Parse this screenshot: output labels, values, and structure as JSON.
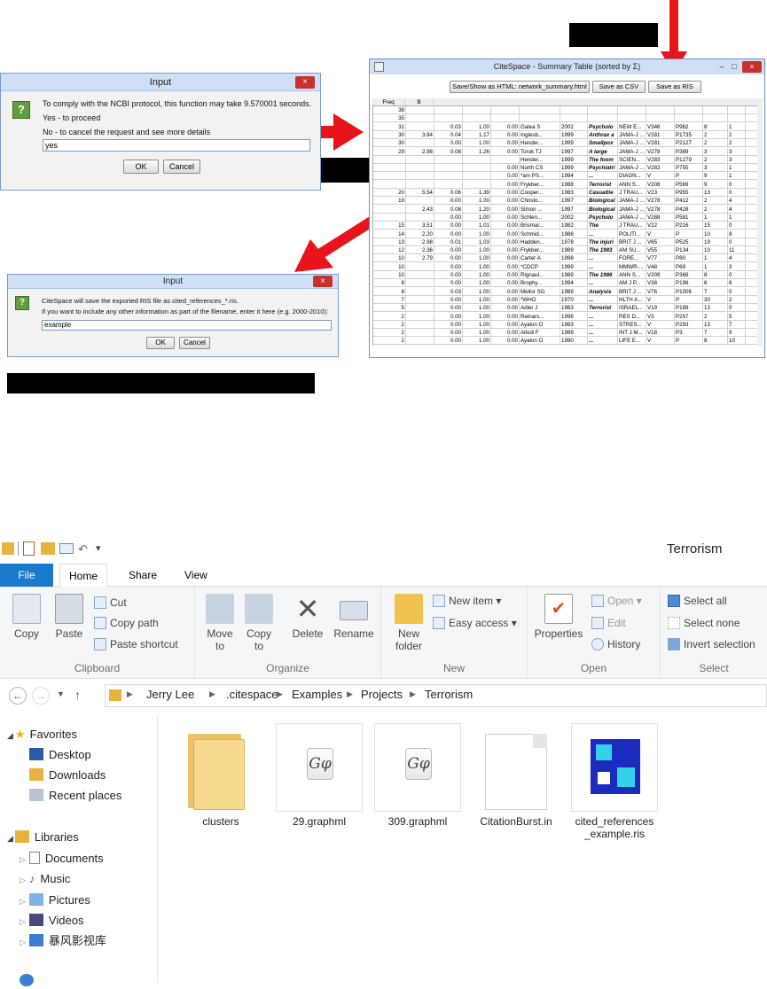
{
  "ncbi_dialog": {
    "title": "Input",
    "close": "×",
    "icon": "?",
    "line1": "To comply with the NCBI protocol, this function may take 9.570001 seconds.",
    "line2": "Yes - to proceed",
    "line3": "No - to cancel the request and see more details",
    "input_value": "yes",
    "ok": "OK",
    "cancel": "Cancel"
  },
  "ris_dialog": {
    "title": "Input",
    "close": "×",
    "icon": "?",
    "line1": "CiteSpace will save the exported RIS file as cited_references_*.ris.",
    "line2": "If you want to include any other information as part of the filename, enter it here (e.g. 2000-2010):",
    "input_value": "example",
    "ok": "OK",
    "cancel": "Cancel"
  },
  "summary_window": {
    "title": "CiteSpace - Summary Table (sorted by Σ)",
    "controls": {
      "min": "–",
      "max": "□",
      "close": "×"
    },
    "buttons": {
      "save_html": "Save/Show as HTML: network_summary.html",
      "save_csv": "Save as CSV",
      "save_ris": "Save as RIS"
    },
    "col_freq": "Freq",
    "col_b": "B",
    "rows": [
      [
        "38",
        "",
        "",
        "",
        "",
        "",
        "",
        "",
        "",
        "",
        "",
        "",
        ""
      ],
      [
        "35",
        "",
        "",
        "",
        "",
        "",
        "",
        "",
        "",
        "",
        "",
        "",
        ""
      ],
      [
        "31",
        "",
        "0.03",
        "1.00",
        "0.00",
        "Galea S",
        "2002",
        "Psycholo",
        "NEW E...",
        "V346",
        "P982",
        "8",
        "1"
      ],
      [
        "30",
        "3.84",
        "0.04",
        "1.17",
        "0.00",
        "Inglesb...",
        "1999",
        "Anthrax a",
        "JAMA-J ...",
        "V281",
        "P1735",
        "2",
        "2"
      ],
      [
        "30",
        "",
        "0.00",
        "1.00",
        "0.00",
        "Hender...",
        "1999",
        "Smallpox",
        "JAMA-J ...",
        "V281",
        "P2127",
        "2",
        "2"
      ],
      [
        "29",
        "2.98",
        "0.08",
        "1.26",
        "0.00",
        "Torok TJ",
        "1997",
        "A large",
        "JAMA-J ...",
        "V278",
        "P389",
        "3",
        "3"
      ],
      [
        "",
        "",
        "",
        "",
        "",
        "Hender...",
        "1999",
        "The foom",
        "SCIEN...",
        "V283",
        "P1279",
        "2",
        "3"
      ],
      [
        "",
        "",
        "",
        "",
        "0.00",
        "North CS",
        "1999",
        "Psychiatri",
        "JAMA-J ...",
        "V282",
        "P755",
        "3",
        "1"
      ],
      [
        "",
        "",
        "",
        "",
        "0.00",
        "*am PS...",
        "1994",
        "...",
        "DIAGN...",
        "V",
        "P",
        "9",
        "1"
      ],
      [
        "",
        "",
        "",
        "",
        "0.00",
        "Frykber...",
        "1988",
        "Terrorist",
        "ANN S...",
        "V208",
        "P569",
        "9",
        "0"
      ],
      [
        "20",
        "5.54",
        "0.06",
        "1.39",
        "0.00",
        "Cooper...",
        "1983",
        "Casualtie",
        "J TRAU...",
        "V23",
        "P955",
        "13",
        "0"
      ],
      [
        "19",
        "",
        "0.00",
        "1.00",
        "0.00",
        "Christo...",
        "1997",
        "Biological",
        "JAMA-J ...",
        "V278",
        "P412",
        "2",
        "4"
      ],
      [
        "",
        "2.43",
        "0.08",
        "1.20",
        "0.00",
        "Simon ...",
        "1997",
        "Biological",
        "JAMA-J ...",
        "V278",
        "P428",
        "2",
        "4"
      ],
      [
        "",
        "",
        "0.00",
        "1.00",
        "0.00",
        "Schlen...",
        "2002",
        "Psycholo",
        "JAMA-J ...",
        "V288",
        "P581",
        "1",
        "1"
      ],
      [
        "15",
        "3.51",
        "0.00",
        "1.01",
        "0.00",
        "Brismar...",
        "1982",
        "The",
        "J TRAU...",
        "V22",
        "P216",
        "15",
        "0"
      ],
      [
        "14",
        "2.20",
        "0.00",
        "1.00",
        "0.00",
        "Schmid...",
        "1988",
        "...",
        "POLITI...",
        "V",
        "P",
        "10",
        "8"
      ],
      [
        "13",
        "2.98",
        "0.01",
        "1.03",
        "0.00",
        "Hadden...",
        "1978",
        "The injuri",
        "BRIT J ...",
        "V65",
        "P525",
        "19",
        "0"
      ],
      [
        "12",
        "2.36",
        "0.00",
        "1.00",
        "0.00",
        "Frykber...",
        "1989",
        "The 1983",
        "AM SU...",
        "V55",
        "P134",
        "10",
        "11"
      ],
      [
        "10",
        "2.79",
        "0.00",
        "1.00",
        "0.00",
        "Carter A",
        "1998",
        "...",
        "FORE...",
        "V77",
        "P80",
        "1",
        "4"
      ],
      [
        "10",
        "",
        "0.00",
        "1.00",
        "0.00",
        "*CDCP",
        "1999",
        "...",
        "MMWR-...",
        "V48",
        "P69",
        "1",
        "3"
      ],
      [
        "10",
        "",
        "0.00",
        "1.00",
        "0.00",
        "Rignaul...",
        "1989",
        "The 1986",
        "ANN S...",
        "V209",
        "P368",
        "8",
        "0"
      ],
      [
        "8",
        "",
        "0.00",
        "1.00",
        "0.00",
        "Brophy...",
        "1994",
        "...",
        "AM J P...",
        "V38",
        "P196",
        "6",
        "6"
      ],
      [
        "8",
        "",
        "0.03",
        "1.00",
        "0.00",
        "Mellor SG",
        "1989",
        "Analysis",
        "BRIT J ...",
        "V76",
        "P1006",
        "7",
        "0"
      ],
      [
        "7",
        "",
        "0.00",
        "1.00",
        "0.00",
        "*WHO",
        "1970",
        "...",
        "HLTH A...",
        "V",
        "P",
        "30",
        "2"
      ],
      [
        "5",
        "",
        "0.00",
        "1.00",
        "0.00",
        "Adler J",
        "1983",
        "Terrorist",
        "ISRAEL...",
        "V19",
        "P189",
        "13",
        "0"
      ],
      [
        "2",
        "",
        "0.00",
        "1.00",
        "0.00",
        "Reinars...",
        "1996",
        "...",
        "RES D...",
        "V3",
        "P297",
        "2",
        "5"
      ],
      [
        "2",
        "",
        "0.00",
        "1.00",
        "0.00",
        "Ayalon O",
        "1983",
        "...",
        "STRES...",
        "V",
        "P293",
        "13",
        "7"
      ],
      [
        "2",
        "",
        "0.00",
        "1.00",
        "0.00",
        "Allodi F",
        "1989",
        "...",
        "INT J M...",
        "V18",
        "P3",
        "7",
        "9"
      ],
      [
        "2",
        "",
        "0.00",
        "1.00",
        "0.00",
        "Ayalon O",
        "1990",
        "...",
        "LIFE E...",
        "V",
        "P",
        "8",
        "10"
      ]
    ]
  },
  "explorer": {
    "window_title": "Terrorism",
    "tabs": {
      "file": "File",
      "home": "Home",
      "share": "Share",
      "view": "View"
    },
    "clipboard": {
      "copy": "Copy",
      "paste": "Paste",
      "cut": "Cut",
      "copy_path": "Copy path",
      "paste_shortcut": "Paste shortcut",
      "label": "Clipboard"
    },
    "organize": {
      "move_to": "Move to",
      "copy_to": "Copy to",
      "delete": "Delete",
      "rename": "Rename",
      "label": "Organize"
    },
    "new": {
      "new_folder": "New folder",
      "new_item": "New item",
      "easy_access": "Easy access",
      "label": "New"
    },
    "open": {
      "properties": "Properties",
      "open": "Open",
      "edit": "Edit",
      "history": "History",
      "label": "Open"
    },
    "select": {
      "select_all": "Select all",
      "select_none": "Select none",
      "invert": "Invert selection",
      "label": "Select"
    },
    "breadcrumb": [
      "Jerry Lee",
      ".citespace",
      "Examples",
      "Projects",
      "Terrorism"
    ],
    "nav": {
      "favorites": "Favorites",
      "desktop": "Desktop",
      "downloads": "Downloads",
      "recent": "Recent places",
      "libraries": "Libraries",
      "documents": "Documents",
      "music": "Music",
      "pictures": "Pictures",
      "videos": "Videos",
      "baofeng": "暴风影视库"
    },
    "files": [
      {
        "name": "clusters"
      },
      {
        "name": "29.graphml"
      },
      {
        "name": "309.graphml"
      },
      {
        "name": "CitationBurst.in"
      },
      {
        "name": "cited_references\n_example.ris"
      }
    ]
  }
}
